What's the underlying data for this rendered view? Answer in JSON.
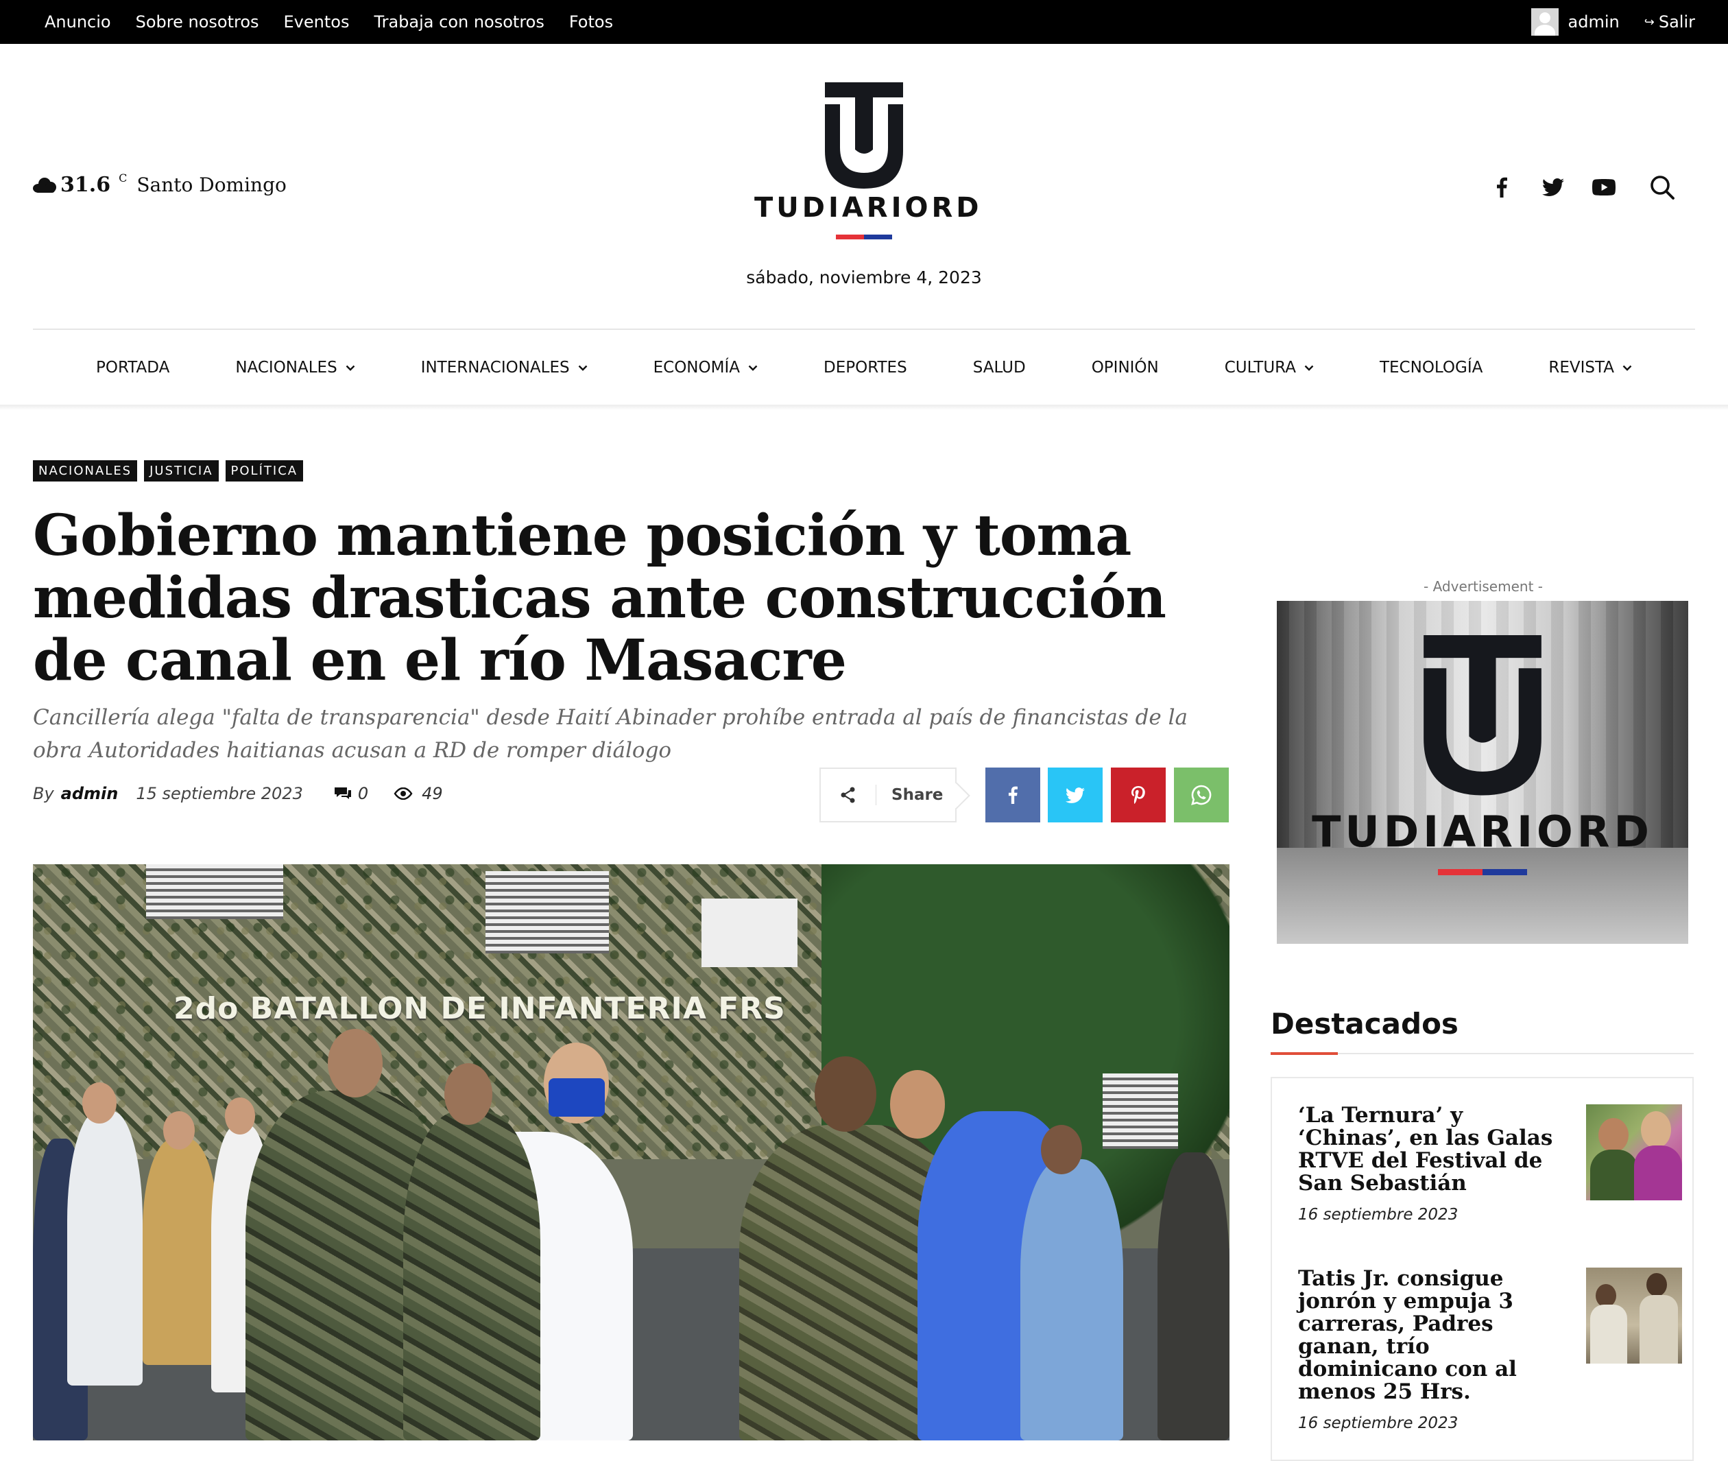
{
  "topbar": {
    "links": [
      "Anuncio",
      "Sobre nosotros",
      "Eventos",
      "Trabaja con nosotros",
      "Fotos"
    ],
    "user": "admin",
    "logout": "Salir"
  },
  "header": {
    "weather": {
      "temp": "31.6",
      "unit": "C",
      "city": "Santo Domingo"
    },
    "logo_text": "TUDIARIORD",
    "date": "sábado, noviembre 4, 2023",
    "social_icons": [
      "facebook-icon",
      "twitter-icon",
      "youtube-icon",
      "search-icon"
    ]
  },
  "nav": [
    {
      "label": "PORTADA",
      "dropdown": false
    },
    {
      "label": "NACIONALES",
      "dropdown": true
    },
    {
      "label": "INTERNACIONALES",
      "dropdown": true
    },
    {
      "label": "ECONOMÍA",
      "dropdown": true
    },
    {
      "label": "DEPORTES",
      "dropdown": false
    },
    {
      "label": "SALUD",
      "dropdown": false
    },
    {
      "label": "OPINIÓN",
      "dropdown": false
    },
    {
      "label": "CULTURA",
      "dropdown": true
    },
    {
      "label": "TECNOLOGÍA",
      "dropdown": false
    },
    {
      "label": "REVISTA",
      "dropdown": true
    }
  ],
  "article": {
    "categories": [
      "NACIONALES",
      "JUSTICIA",
      "POLÍTICA"
    ],
    "title": "Gobierno mantiene posición y toma medidas drasticas ante construcción de canal en el río Masacre",
    "subtitle": "Cancillería alega \"falta de transparencia\" desde Haití Abinader prohíbe entrada al país de financistas de la obra Autoridades haitianas acusan a RD de romper diálogo",
    "by": "By",
    "author": "admin",
    "date": "15 septiembre 2023",
    "comments": "0",
    "views": "49",
    "share_label": "Share",
    "share_colors": {
      "facebook": "#516eab",
      "twitter": "#29c5f6",
      "pinterest": "#ca212a",
      "whatsapp": "#7bbf6a"
    },
    "hero_sign": "2do BATALLON DE INFANTERIA FRS"
  },
  "sidebar": {
    "ad_label": "- Advertisement -",
    "ad_logo_text": "TUDIARIORD",
    "featured_title": "Destacados",
    "featured": [
      {
        "title": "‘La Ternura’ y ‘Chinas’, en las Galas RTVE del Festival de San Sebastián",
        "date": "16 septiembre 2023"
      },
      {
        "title": "Tatis Jr. consigue jonrón y empuja 3 carreras, Padres ganan, trío dominicano con al menos 25 Hrs.",
        "date": "16 septiembre 2023"
      }
    ]
  },
  "colors": {
    "accent": "#e04e39",
    "flag_red": "#e53238",
    "flag_blue": "#1f3a9c"
  }
}
